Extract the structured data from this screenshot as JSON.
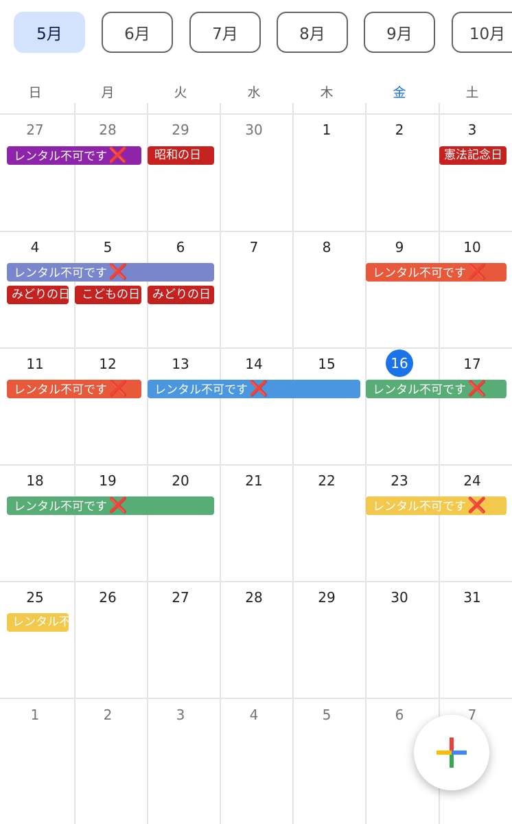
{
  "month_tabs": [
    "5月",
    "6月",
    "7月",
    "8月",
    "9月",
    "10月"
  ],
  "weekdays": [
    "日",
    "月",
    "火",
    "水",
    "木",
    "金",
    "土"
  ],
  "weeks": [
    [
      "27",
      "28",
      "29",
      "30",
      "1",
      "2",
      "3"
    ],
    [
      "4",
      "5",
      "6",
      "7",
      "8",
      "9",
      "10"
    ],
    [
      "11",
      "12",
      "13",
      "14",
      "15",
      "16",
      "17"
    ],
    [
      "18",
      "19",
      "20",
      "21",
      "22",
      "23",
      "24"
    ],
    [
      "25",
      "26",
      "27",
      "28",
      "29",
      "30",
      "31"
    ],
    [
      "1",
      "2",
      "3",
      "4",
      "5",
      "6",
      "7"
    ]
  ],
  "today": "16",
  "events": {
    "rental": "レンタル不可です",
    "rental_short": "レンタル不",
    "cross": "❌",
    "showa": "昭和の日",
    "kenpo": "憲法記念日",
    "midori": "みどりの日",
    "kodomo": "こどもの日",
    "midori2": "みどりの日"
  },
  "colors": {
    "purple": "#8e24aa",
    "red": "#d50000",
    "lavender": "#7986cb",
    "orange": "#f4511e",
    "blue": "#4a97e0",
    "green": "#57ad75",
    "yellow": "#f2c94c",
    "today_blue": "#1a73e8"
  },
  "fab": {
    "icon": "plus-icon"
  }
}
